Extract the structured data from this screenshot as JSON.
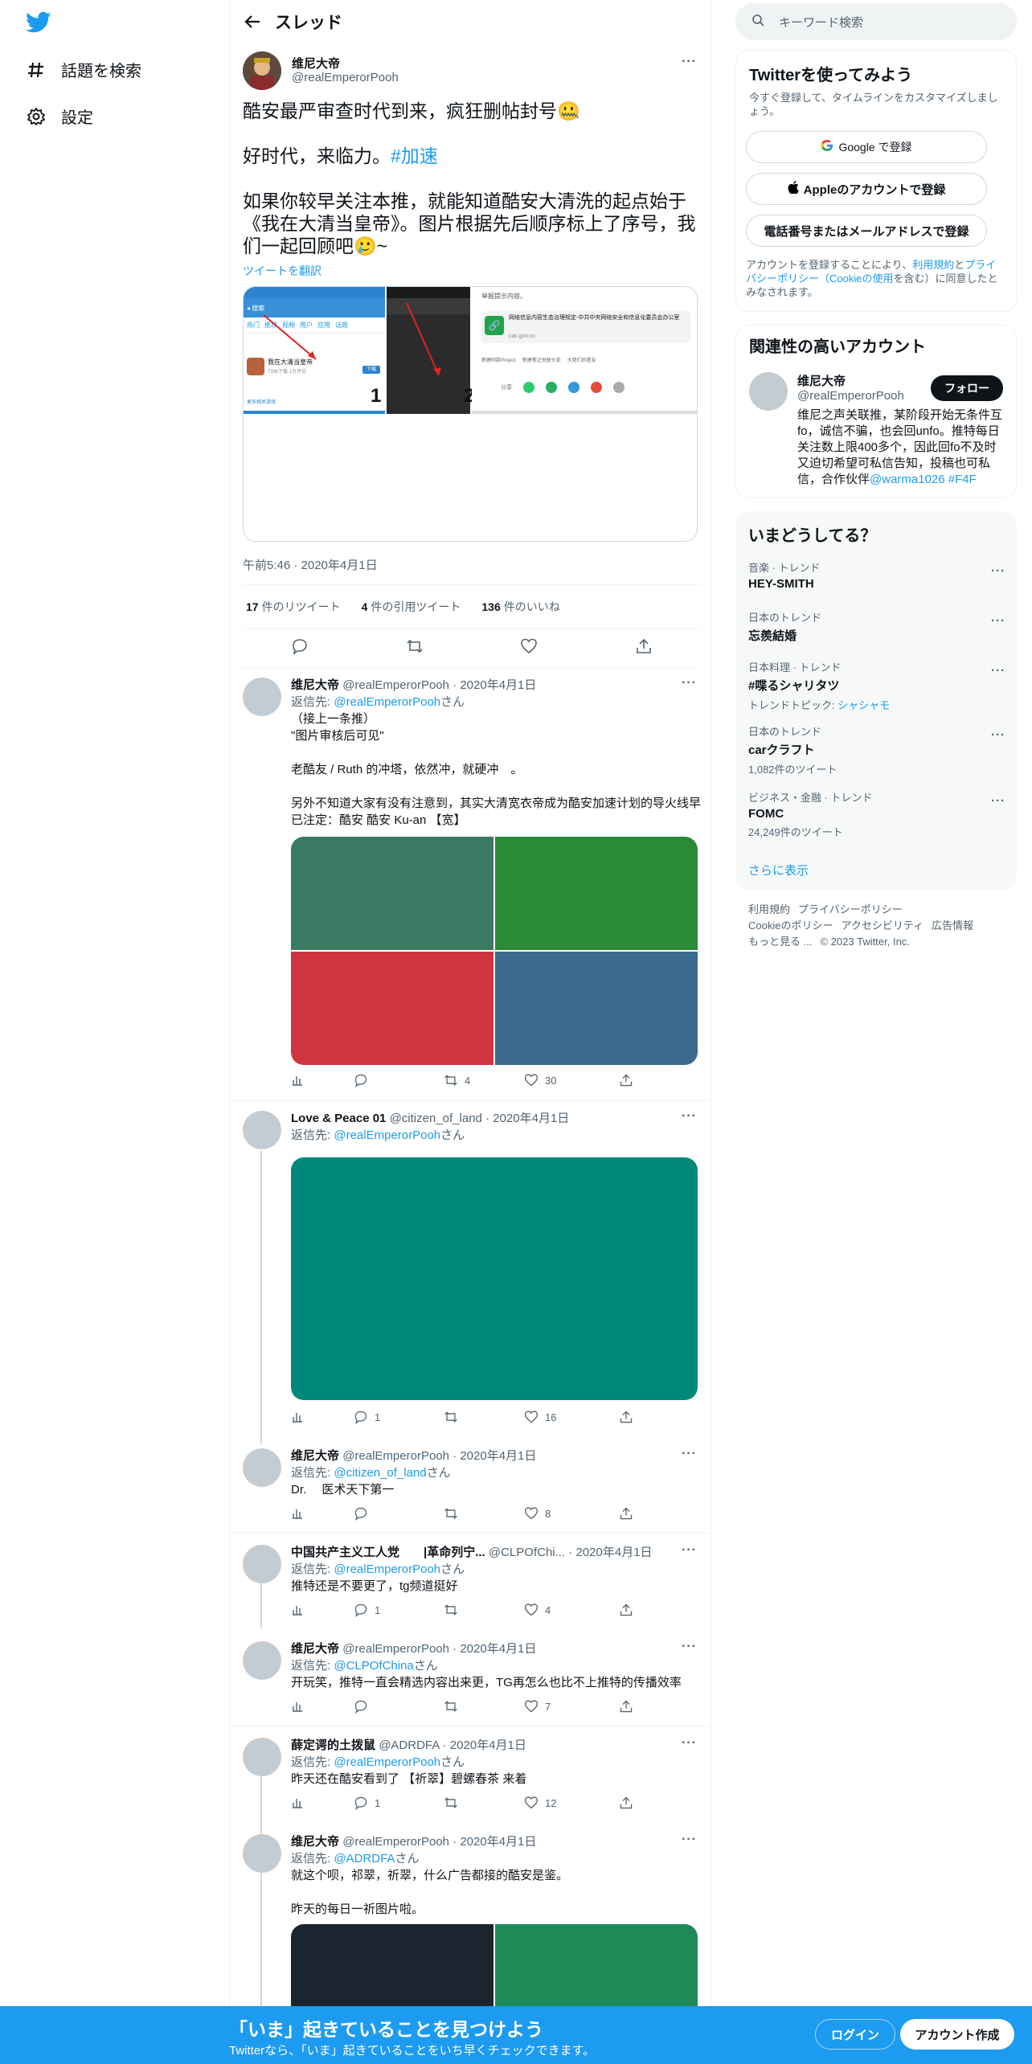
{
  "nav": {
    "explore_label": "話題を検索",
    "settings_label": "設定"
  },
  "header": {
    "title": "スレッド"
  },
  "main_tweet": {
    "name": "维尼大帝",
    "handle": "@realEmperorPooh",
    "line1": "酷安最严审查时代到来，疯狂删帖封号🤐",
    "line2_text": "好时代，来临力。",
    "line2_tag": "#加速",
    "line3": "如果你较早关注本推，就能知道酷安大清洗的起点始于《我在大清当皇帝》。图片根据先后顺序标上了序号，我们一起回顾吧🥲~",
    "translate": "ツイートを翻訳",
    "timestamp": "午前5:46 · 2020年4月1日",
    "retweets": "17",
    "retweets_label": "件のリツイート",
    "quotes": "4",
    "quotes_label": "件の引用ツイート",
    "likes": "136",
    "likes_label": "件のいいね",
    "media": {
      "s1_tabs": [
        "热门",
        "推荐",
        "视频",
        "用户",
        "应用",
        "话题"
      ],
      "s1_app_name": "我在大清当皇帝",
      "s1_app_stats": "720k下载  1万评论",
      "s1_download": "下载",
      "s1_link": "更多相关游戏",
      "s1_number": "1",
      "s2_number": "2",
      "s3_notice": "举报提示内容。",
      "s3_link_title": "网络信息内容生态治理规定-中共中央网络安全和信息化委员会办公室",
      "s3_link_url": "cac.gov.cn",
      "s3_chip1": "新建同款Project",
      "s3_chip2": "新建笔记关联头条",
      "s3_chip3": "大佬们的星友",
      "s3_share": "分享"
    }
  },
  "replies": [
    {
      "name": "维尼大帝",
      "handle": "@realEmperorPooh",
      "date": "2020年4月1日",
      "reply_to_label": "返信先:",
      "reply_to": "@realEmperorPooh",
      "san": "さん",
      "lines": [
        "（接上一条推）",
        "\"图片审核后可见\"",
        "",
        "老酷友 / Ruth 的冲塔，依然冲，就硬冲　。",
        "",
        "另外不知道大家有没有注意到，其实大清宽衣帝成为酷安加速计划的导火线早已注定：酷安 酷安 Ku-an 【宽】"
      ],
      "stats": {
        "reply": "",
        "retweet": "4",
        "like": "30"
      }
    },
    {
      "name": "Love & Peace 01",
      "handle": "@citizen_of_land",
      "date": "2020年4月1日",
      "reply_to_label": "返信先:",
      "reply_to": "@realEmperorPooh",
      "san": "さん",
      "stats": {
        "reply": "1",
        "retweet": "",
        "like": "16"
      }
    },
    {
      "name": "维尼大帝",
      "handle": "@realEmperorPooh",
      "date": "2020年4月1日",
      "reply_to_label": "返信先:",
      "reply_to": "@citizen_of_land",
      "san": "さん",
      "text": "Dr.　 医术天下第一",
      "stats": {
        "reply": "",
        "retweet": "",
        "like": "8"
      }
    },
    {
      "name": "中国共产主义工人党　　|革命列宁...",
      "handle": "@CLPOfChi...",
      "date": "2020年4月1日",
      "reply_to_label": "返信先:",
      "reply_to": "@realEmperorPooh",
      "san": "さん",
      "text": "推特还是不要更了，tg频道挺好",
      "stats": {
        "reply": "1",
        "retweet": "",
        "like": "4"
      }
    },
    {
      "name": "维尼大帝",
      "handle": "@realEmperorPooh",
      "date": "2020年4月1日",
      "reply_to_label": "返信先:",
      "reply_to": "@CLPOfChina",
      "san": "さん",
      "text": "开玩笑，推特一直会精选内容出来更，TG再怎么也比不上推特的传播效率",
      "stats": {
        "reply": "",
        "retweet": "",
        "like": "7"
      }
    },
    {
      "name": "薛定谔的土拨鼠",
      "handle": "@ADRDFA",
      "date": "2020年4月1日",
      "reply_to_label": "返信先:",
      "reply_to": "@realEmperorPooh",
      "san": "さん",
      "text": "昨天还在酷安看到了 【祈翠】碧螺春茶 来着",
      "stats": {
        "reply": "1",
        "retweet": "",
        "like": "12"
      }
    },
    {
      "name": "维尼大帝",
      "handle": "@realEmperorPooh",
      "date": "2020年4月1日",
      "reply_to_label": "返信先:",
      "reply_to": "@ADRDFA",
      "san": "さん",
      "text1": "就这个呗，祁翠，祈翠，什么广告都接的酷安是鉴。",
      "text2": "昨天的每日一祈图片啦。"
    }
  ],
  "right": {
    "search_placeholder": "キーワード検索",
    "signup_box": {
      "title": "Twitterを使ってみよう",
      "subtitle": "今すぐ登録して、タイムラインをカスタマイズしましょう。",
      "google": "Google で登録",
      "apple": "Appleのアカウントで登録",
      "phone": "電話番号またはメールアドレスで登録",
      "terms_pre": "アカウントを登録することにより、",
      "terms_link1": "利用規約",
      "terms_mid": "と",
      "terms_link2": "プライバシーポリシー（Cookieの使用",
      "terms_post": "を含む）に同意したとみなされます。"
    },
    "related": {
      "title": "関連性の高いアカウント",
      "name": "维尼大帝",
      "handle": "@realEmperorPooh",
      "follow": "フォロー",
      "bio": "维尼之声关联推，某阶段开始无条件互fo，诚信不骗，也会回unfo。推特每日关注数上限400多个，因此回fo不及时又迫切希望可私信告知，投稿也可私信，合作伙伴",
      "bio_link1": "@warma1026",
      "bio_link2": "#F4F"
    },
    "trends": {
      "title": "いまどうしてる？",
      "items": [
        {
          "meta": "音楽 · トレンド",
          "name": "HEY-SMITH",
          "count": ""
        },
        {
          "meta": "日本のトレンド",
          "name": "忘羨結婚",
          "count": ""
        },
        {
          "meta": "日本料理 · トレンド",
          "name": "#喋るシャリタツ",
          "count": "トレンドトピック: ",
          "topic": "シャシャモ"
        },
        {
          "meta": "日本のトレンド",
          "name": "carクラフト",
          "count": "1,082件のツイート"
        },
        {
          "meta": "ビジネス・金融 · トレンド",
          "name": "FOMC",
          "count": "24,249件のツイート"
        }
      ],
      "more": "さらに表示"
    },
    "footer": {
      "l1": "利用規約",
      "l2": "プライバシーポリシー",
      "l3": "Cookieのポリシー",
      "l4": "アクセシビリティ",
      "l5": "広告情報",
      "l6": "もっと見る ...",
      "l7": "© 2023 Twitter, Inc."
    }
  },
  "banner": {
    "title": "「いま」起きていることを見つけよう",
    "subtitle": "Twitterなら、「いま」起きていることをいち早くチェックできます。",
    "login": "ログイン",
    "signup": "アカウント作成"
  },
  "colors": {
    "accent": "#1d9bf0",
    "text": "#0f1419",
    "secondary": "#536471"
  },
  "media_colors": {
    "reply1": [
      "#3a7a62",
      "#2a8a35",
      "#d0343e",
      "#3a6a8f"
    ],
    "reply2": "#00897b",
    "reply7": [
      "#1b2530",
      "#1f8a58"
    ]
  }
}
